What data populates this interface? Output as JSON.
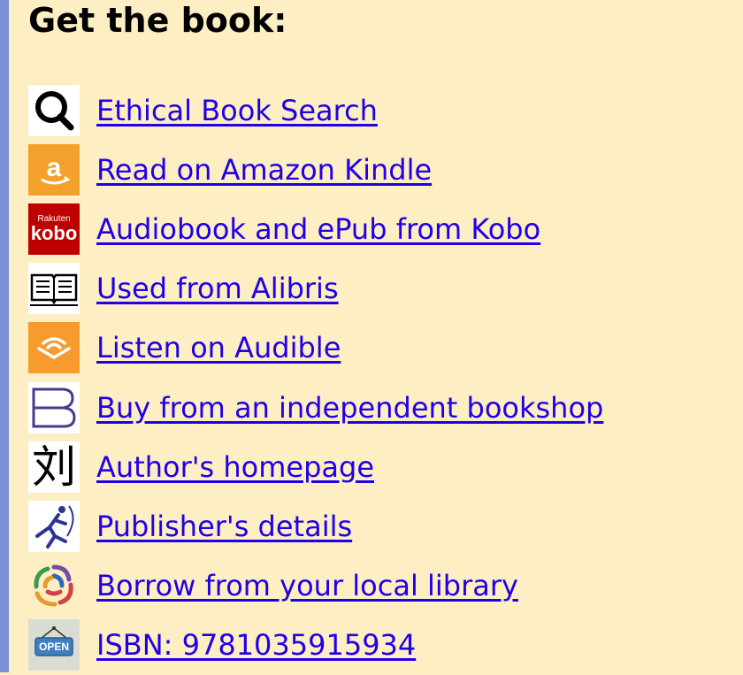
{
  "heading": "Get the book:",
  "links": [
    {
      "label": "Ethical Book Search",
      "icon": "search-icon"
    },
    {
      "label": "Read on Amazon Kindle",
      "icon": "amazon-icon"
    },
    {
      "label": "Audiobook and ePub from Kobo",
      "icon": "kobo-icon",
      "icon_text_top": "Rakuten",
      "icon_text_bottom": "kobo"
    },
    {
      "label": "Used from Alibris",
      "icon": "open-book-icon"
    },
    {
      "label": "Listen on Audible",
      "icon": "audible-icon"
    },
    {
      "label": "Buy from an independent bookshop",
      "icon": "bookshop-icon"
    },
    {
      "label": "Author's homepage",
      "icon": "author-glyph-icon",
      "icon_text": "刘"
    },
    {
      "label": "Publisher's details",
      "icon": "publisher-runner-icon"
    },
    {
      "label": "Borrow from your local library",
      "icon": "library-swirl-icon"
    },
    {
      "label": "ISBN: 9781035915934",
      "icon": "open-sign-icon",
      "icon_text": "OPEN"
    }
  ],
  "colors": {
    "background": "#fdeec3",
    "left_bar": "#7b8fd6",
    "link": "#1f00e8",
    "amazon_orange": "#f4a02c",
    "kobo_red": "#bf0000",
    "audible_orange": "#f79b2e"
  }
}
